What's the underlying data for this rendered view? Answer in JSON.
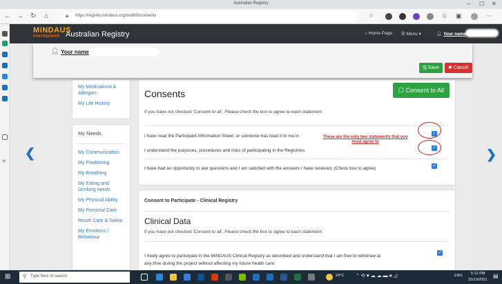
{
  "browser": {
    "window_title": "Australian Registry",
    "url": "https://registry.mindaus.org/mndl/8/consents"
  },
  "app": {
    "logo_main": "MiNDAUS",
    "logo_sub": "PARTNERSHIP",
    "name": "Australian Registry",
    "nav": {
      "home": "Home Page",
      "menu": "Menu",
      "user": "Your name"
    }
  },
  "userbar": {
    "user": "Your name",
    "save": "Save",
    "cancel": "Cancel"
  },
  "sidebar": {
    "top_links": [
      "My Medications & Allergies",
      "My Life History"
    ],
    "needs_heading": "My Needs",
    "needs_links": [
      "My Communication",
      "My Positioning",
      "My Breathing",
      "My Eating and Drinking needs",
      "My Physical Ability",
      "My Personal Care",
      "Mouth Care & Saliva",
      "My Emotions / Behaviour"
    ]
  },
  "consents": {
    "title": "Consents",
    "consent_all": "Consent to All",
    "instruction": "If you have not checked 'Consent to all', Please check the box to agree to each statement",
    "statements": [
      "I have read the Participant Information Sheet, or someone has read it to me in",
      "I understand the purposes, procedures and risks of participating in the Registries.",
      "I have had an opportunity to ask questions and I am satisfied with the answers I have received. (Check box to agree)"
    ],
    "annotation": "These are the only two statements that you must agree to"
  },
  "clinical": {
    "section_label": "Consent to Participate - Clinical Registry",
    "title": "Clinical Data",
    "instruction": "If you have not checked 'Consent to all', Please check the box to agree to each statement",
    "statement_line1": "I freely agree to participate in the MiNDAUS Clinical Registry as described and understand that I am free to withdraw at",
    "statement_line2": "any time during the project without affecting my future health care."
  },
  "taskbar": {
    "search_placeholder": "Type here to search",
    "temp": "24°C",
    "lang": "ENG",
    "time": "5:12 PM",
    "date": "15/10/2021"
  }
}
